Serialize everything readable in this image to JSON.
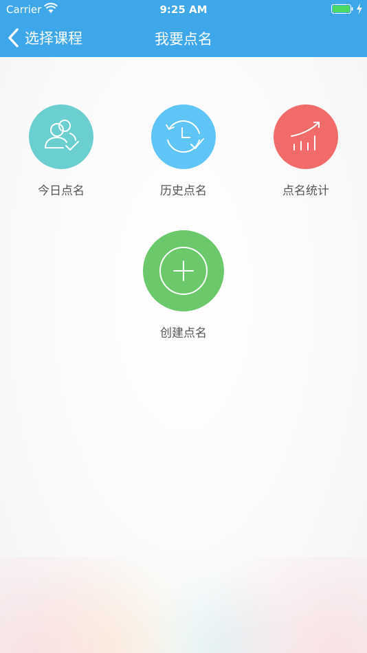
{
  "status_bar": {
    "carrier": "Carrier",
    "time": "9:25 AM"
  },
  "nav": {
    "back_label": "选择课程",
    "title": "我要点名"
  },
  "colors": {
    "header_bg": "#3ea7ea",
    "today": "#6ccfcf",
    "history": "#5ec5f6",
    "stats": "#f16b6b",
    "create": "#6cc96b",
    "battery": "#4cd964"
  },
  "tiles": [
    {
      "id": "today",
      "label": "今日点名",
      "icon": "users-check-icon"
    },
    {
      "id": "history",
      "label": "历史点名",
      "icon": "clock-history-icon"
    },
    {
      "id": "stats",
      "label": "点名统计",
      "icon": "bar-chart-icon"
    },
    {
      "id": "create",
      "label": "创建点名",
      "icon": "plus-circle-icon"
    }
  ]
}
